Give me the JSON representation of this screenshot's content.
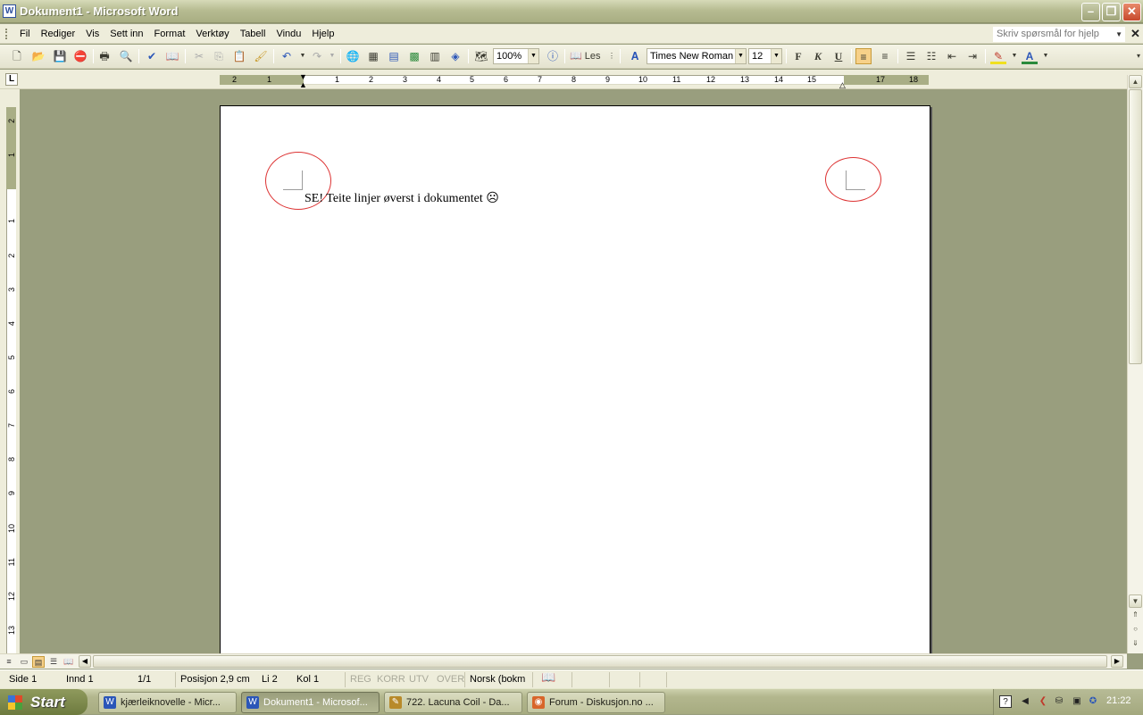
{
  "window": {
    "title": "Dokument1 - Microsoft Word",
    "app_icon": "W"
  },
  "menubar": {
    "items": [
      "Fil",
      "Rediger",
      "Vis",
      "Sett inn",
      "Format",
      "Verktøy",
      "Tabell",
      "Vindu",
      "Hjelp"
    ],
    "help_placeholder": "Skriv spørsmål for hjelp"
  },
  "toolbar": {
    "zoom": "100%",
    "read_label": "Les",
    "font": "Times New Roman",
    "font_size": "12",
    "bold": "F",
    "italic": "K",
    "underline": "U",
    "font_color_glyph": "A"
  },
  "ruler": {
    "h_numbers": [
      "2",
      "1",
      "1",
      "2",
      "3",
      "4",
      "5",
      "6",
      "7",
      "8",
      "9",
      "10",
      "11",
      "12",
      "13",
      "14",
      "15",
      "17",
      "18"
    ],
    "v_numbers": [
      "2",
      "1",
      "1",
      "2",
      "3",
      "4",
      "5",
      "6",
      "7",
      "8",
      "9",
      "10",
      "11",
      "12",
      "13"
    ]
  },
  "document": {
    "text": "SE! Teite linjer øverst i dokumentet ☹"
  },
  "statusbar": {
    "page": "Side  1",
    "section": "Innd  1",
    "pages": "1/1",
    "position": "Posisjon  2,9 cm",
    "line": "Li  2",
    "column": "Kol  1",
    "modes": [
      "REG",
      "KORR",
      "UTV",
      "OVER"
    ],
    "language": "Norsk (bokm"
  },
  "taskbar": {
    "start": "Start",
    "tasks": [
      {
        "label": "kjærleiknovelle - Micr...",
        "active": false,
        "icon": "word-icon",
        "color": "#2b56b8"
      },
      {
        "label": "Dokument1 - Microsof...",
        "active": true,
        "icon": "word-icon",
        "color": "#2b56b8"
      },
      {
        "label": "722. Lacuna Coil - Da...",
        "active": false,
        "icon": "pencil-icon",
        "color": "#b88a2a"
      },
      {
        "label": "Forum - Diskusjon.no ...",
        "active": false,
        "icon": "firefox-icon",
        "color": "#d8652a"
      }
    ],
    "clock": "21:22"
  }
}
